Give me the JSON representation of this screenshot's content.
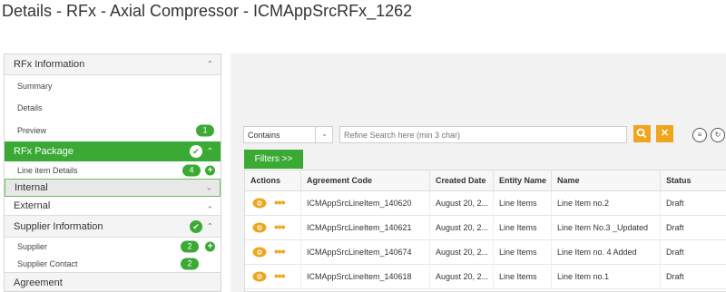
{
  "page": {
    "title": "Details - RFx - Axial Compressor - ICMAppSrcRFx_1262"
  },
  "sidebar": {
    "rfx_information": {
      "label": "RFx Information"
    },
    "summary": {
      "label": "Summary"
    },
    "details": {
      "label": "Details"
    },
    "preview": {
      "label": "Preview",
      "badge": "1"
    },
    "rfx_package": {
      "label": "RFx Package"
    },
    "line_item_details": {
      "label": "Line item Details",
      "badge": "4"
    },
    "internal": {
      "label": "Internal"
    },
    "external": {
      "label": "External"
    },
    "supplier_information": {
      "label": "Supplier Information"
    },
    "supplier": {
      "label": "Supplier",
      "badge": "2"
    },
    "supplier_contact": {
      "label": "Supplier Contact",
      "badge": "2"
    },
    "agreement": {
      "label": "Agreement"
    }
  },
  "toolbar": {
    "filter_select_value": "Contains",
    "search_placeholder": "Refine Search here (min 3 char)",
    "filters_label": "Filters >>",
    "accent_color": "#f0a51e",
    "brand_color": "#3aaa35"
  },
  "table": {
    "columns": [
      "Actions",
      "Agreement Code",
      "Created Date",
      "Entity Name",
      "Name",
      "Status"
    ],
    "rows": [
      {
        "code": "ICMAppSrcLineItem_140620",
        "date": "August 20, 2...",
        "entity": "Line Items",
        "name": "Line Item no.2",
        "status": "Draft"
      },
      {
        "code": "ICMAppSrcLineItem_140621",
        "date": "August 20, 2...",
        "entity": "Line Items",
        "name": "Line Item No.3 _Updated",
        "status": "Draft"
      },
      {
        "code": "ICMAppSrcLineItem_140674",
        "date": "August 20, 2...",
        "entity": "Line Items",
        "name": "Line Item no. 4 Added",
        "status": "Draft"
      },
      {
        "code": "ICMAppSrcLineItem_140618",
        "date": "August 20, 2...",
        "entity": "Line Items",
        "name": "Line Item no.1",
        "status": "Draft"
      }
    ]
  }
}
